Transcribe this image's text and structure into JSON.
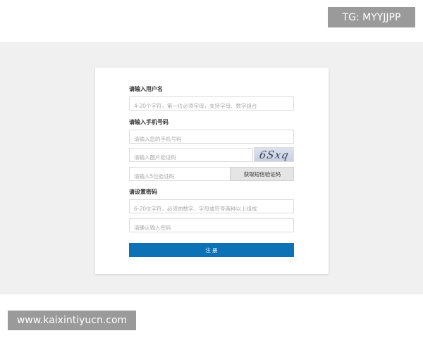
{
  "watermarks": {
    "tg": "TG: MYYJJPP",
    "url": "www.kaixintiyucn.com"
  },
  "form": {
    "username": {
      "label": "请输入用户名",
      "placeholder": "4-20个字符，第一位必须字母，支持字母、数字组合"
    },
    "phone": {
      "label": "请输入手机号码",
      "placeholder": "请输入您的手机号码"
    },
    "image_code": {
      "placeholder": "请输入图片验证码",
      "captcha_text": "6Sxq"
    },
    "sms_code": {
      "placeholder": "请输入5位验证码",
      "button": "获取短信验证码"
    },
    "password": {
      "label": "请设置密码",
      "placeholder": "6-20位字符，必须由数字、字母或符号两种以上组成",
      "confirm_placeholder": "请确认输入密码"
    },
    "submit": "注 册"
  },
  "colors": {
    "primary_button": "#0d72b5",
    "band_background": "#f0f0f0",
    "watermark_bg": "#9a9a9a"
  }
}
